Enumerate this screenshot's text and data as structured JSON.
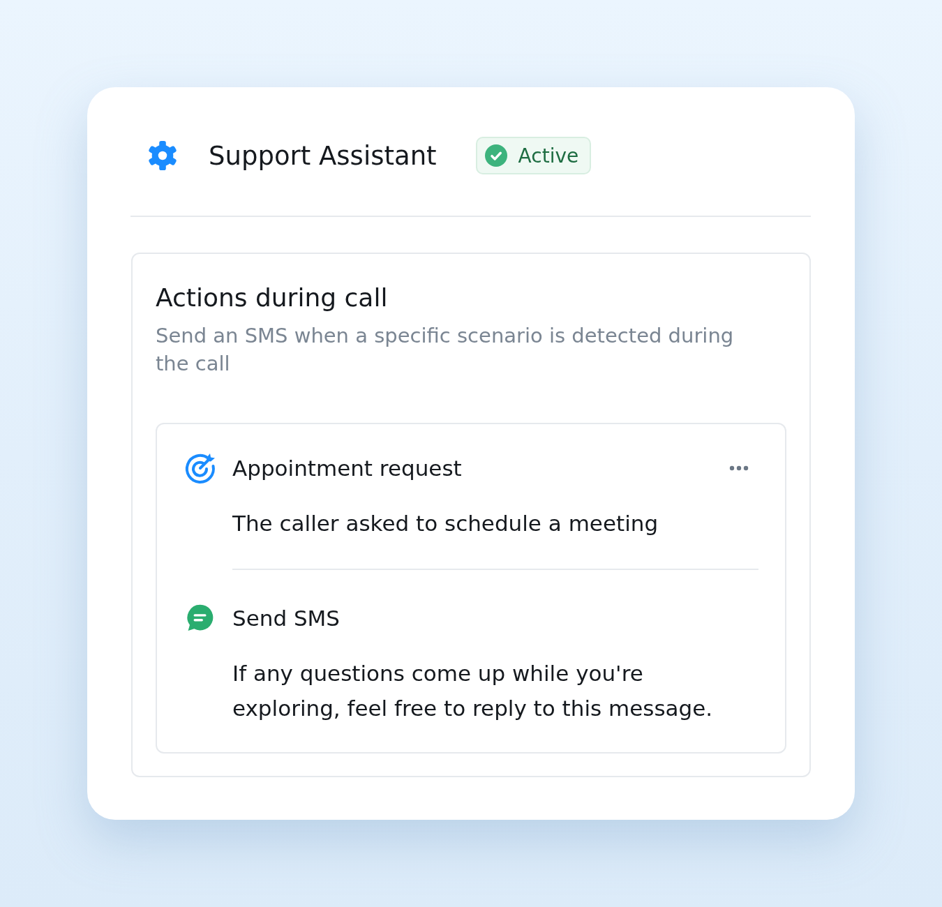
{
  "assistant": {
    "name": "Support Assistant",
    "status": {
      "kind": "active",
      "label": "Active"
    }
  },
  "section": {
    "title": "Actions during call",
    "description": "Send an SMS when a specific scenario is detected during the call",
    "steps": [
      {
        "kind": "trigger",
        "title": "Appointment request",
        "text": "The caller asked to schedule a meeting"
      },
      {
        "kind": "action",
        "title": "Send SMS",
        "text": "If any questions come up while you're exploring, feel free to reply to this message."
      }
    ]
  }
}
